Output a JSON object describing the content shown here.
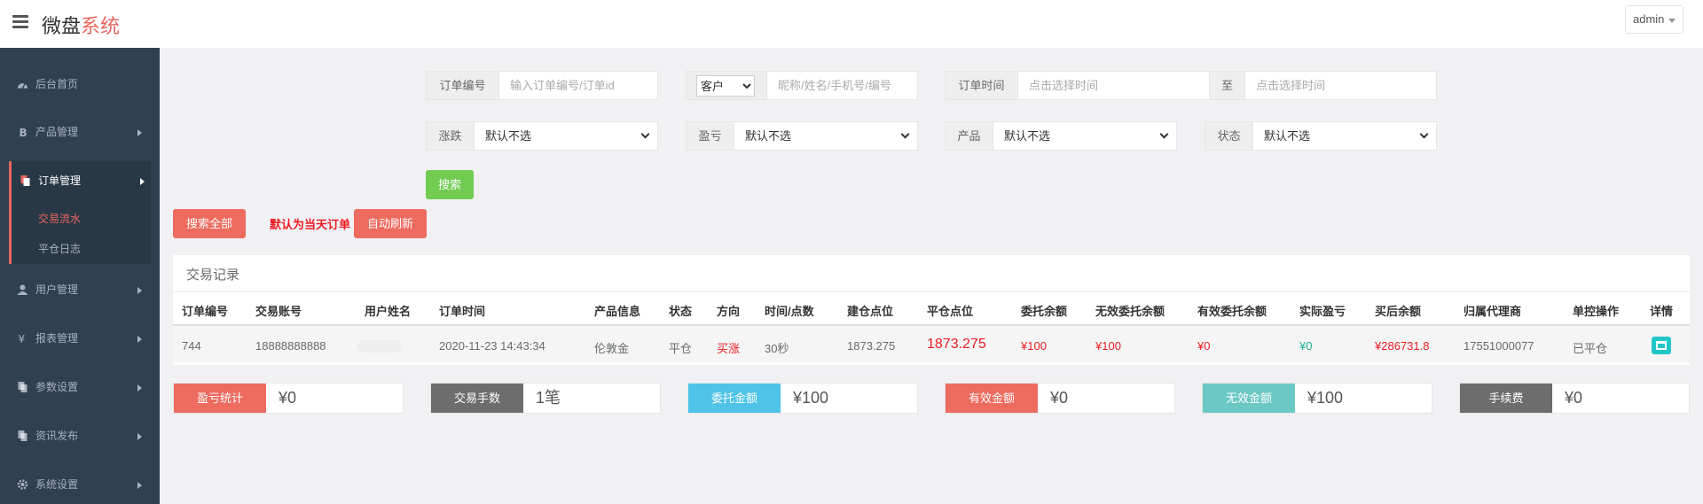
{
  "header": {
    "brand_main": "微盘",
    "brand_accent": "系统",
    "user": "admin"
  },
  "sidebar": {
    "items": [
      {
        "label": "后台首页",
        "icon": "dashboard-icon"
      },
      {
        "label": "产品管理",
        "icon": "bitcoin-icon"
      },
      {
        "label": "订单管理",
        "icon": "document-icon"
      },
      {
        "label": "用户管理",
        "icon": "user-icon"
      },
      {
        "label": "报表管理",
        "icon": "yen-icon"
      },
      {
        "label": "参数设置",
        "icon": "document-icon"
      },
      {
        "label": "资讯发布",
        "icon": "document-icon"
      },
      {
        "label": "系统设置",
        "icon": "gear-icon"
      }
    ],
    "sub_items": [
      {
        "label": "交易流水",
        "active": true
      },
      {
        "label": "平仓日志",
        "active": false
      }
    ]
  },
  "filters": {
    "order_no_label": "订单编号",
    "order_no_placeholder": "输入订单编号/订单id",
    "customer_select": "客户",
    "customer_placeholder": "昵称/姓名/手机号/编号",
    "order_time_label": "订单时间",
    "time_start_placeholder": "点击选择时间",
    "time_to": "至",
    "time_end_placeholder": "点击选择时间",
    "rise_fall_label": "涨跌",
    "profit_loss_label": "盈亏",
    "product_label": "产品",
    "status_label": "状态",
    "default_option": "默认不选",
    "search_button": "搜索"
  },
  "actions": {
    "search_all": "搜索全部",
    "default_note": "默认为当天订单",
    "auto_refresh": "自动刷新"
  },
  "table": {
    "title": "交易记录",
    "headers": [
      "订单编号",
      "交易账号",
      "用户姓名",
      "订单时间",
      "产品信息",
      "状态",
      "方向",
      "时间/点数",
      "建仓点位",
      "平仓点位",
      "委托余额",
      "无效委托余额",
      "有效委托余额",
      "实际盈亏",
      "买后余额",
      "归属代理商",
      "单控操作",
      "详情"
    ],
    "rows": [
      {
        "order_no": "744",
        "account": "18888888888",
        "order_time": "2020-11-23 14:43:34",
        "product": "伦敦金",
        "status": "平仓",
        "direction": "买涨",
        "duration": "30秒",
        "open_price": "1873.275",
        "close_price": "1873.275",
        "entrust": "¥100",
        "invalid_entrust": "¥100",
        "valid_entrust": "¥0",
        "actual_pnl": "¥0",
        "balance_after": "¥286731.8",
        "agent": "17551000077",
        "control": "已平仓"
      }
    ]
  },
  "stats": [
    {
      "label": "盈亏统计",
      "value": "¥0",
      "color": "#ed6b5f"
    },
    {
      "label": "交易手数",
      "value": "1笔",
      "color": "#6d6d6d"
    },
    {
      "label": "委托金额",
      "value": "¥100",
      "color": "#4fc3e8"
    },
    {
      "label": "有效金额",
      "value": "¥0",
      "color": "#ed6b5f"
    },
    {
      "label": "无效金额",
      "value": "¥100",
      "color": "#6cc8c4"
    },
    {
      "label": "手续费",
      "value": "¥0",
      "color": "#6d6d6d"
    }
  ],
  "colors": {
    "sidebar_bg": "#2f4050",
    "accent_red": "#e8675d",
    "search_green": "#72cc52",
    "profit_green": "#1ab394",
    "loss_red": "#ed1c24"
  }
}
